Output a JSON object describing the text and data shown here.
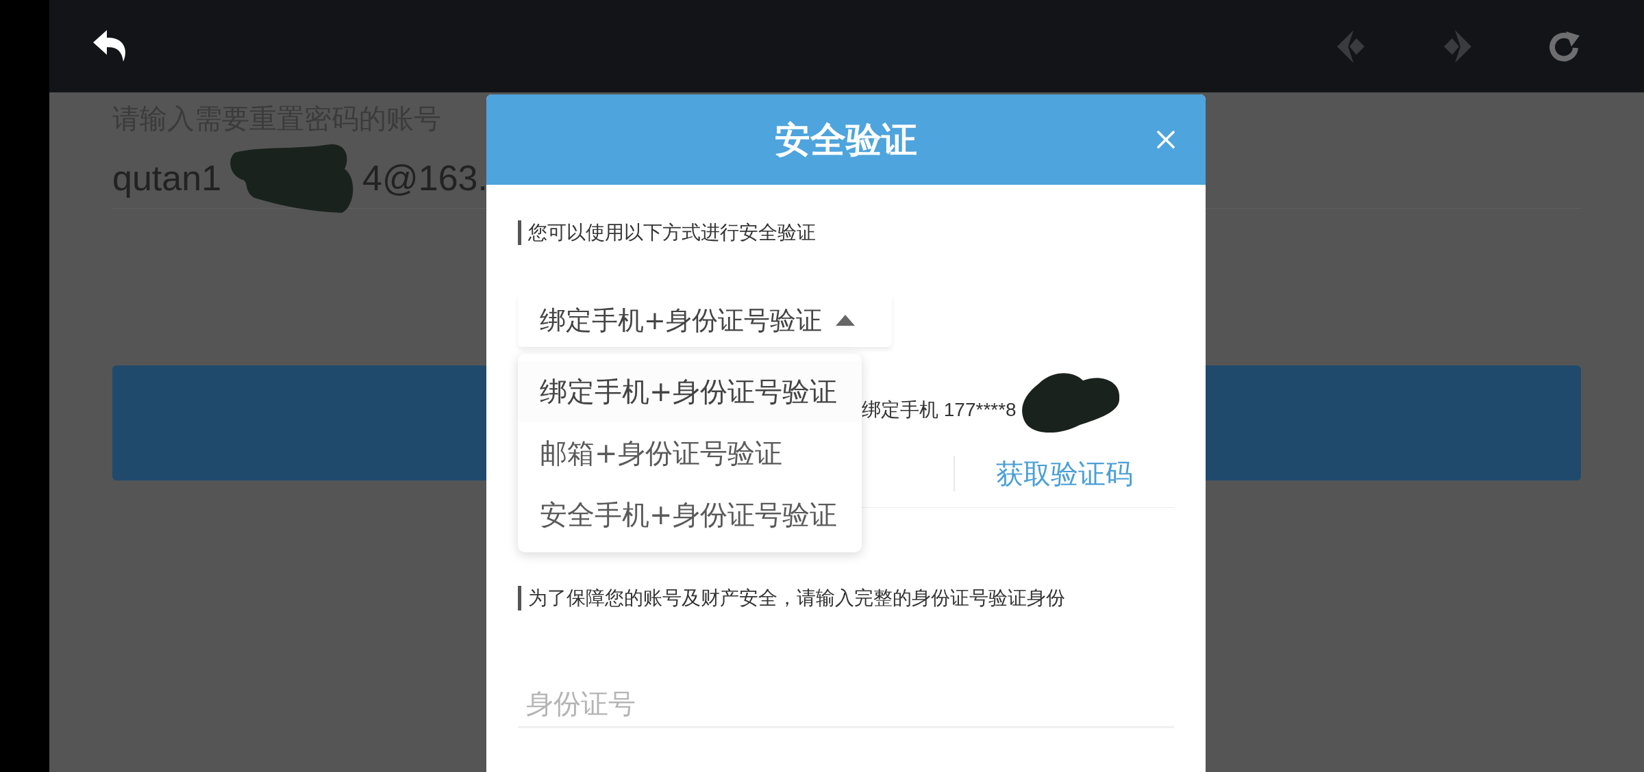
{
  "toolbar": [
    {
      "kind": "back",
      "disabled": false
    },
    {
      "kind": "prev",
      "disabled": true
    },
    {
      "kind": "next",
      "disabled": true
    },
    {
      "kind": "refresh",
      "disabled": false
    }
  ],
  "page": {
    "account_label": "请输入需要重置密码的账号",
    "account_value_start": "qutan1",
    "account_value_end": "4@163."
  },
  "dialog": {
    "title": "安全验证",
    "method_section": "您可以使用以下方式进行安全验证",
    "method_select": {
      "value": "绑定手机+身份证号验证",
      "expanded": true
    },
    "method_options": [
      {
        "label": "绑定手机+身份证号验证",
        "selected": true
      },
      {
        "label": "邮箱+身份证号验证",
        "selected": false
      },
      {
        "label": "安全手机+身份证号验证",
        "selected": false
      }
    ],
    "phone_text": "绑定手机 177****8",
    "code_button": "获取验证码",
    "id_section": "为了保障您的账号及财产安全，请输入完整的身份证号验证身份",
    "id_field": {
      "placeholder": "身份证号"
    }
  }
}
